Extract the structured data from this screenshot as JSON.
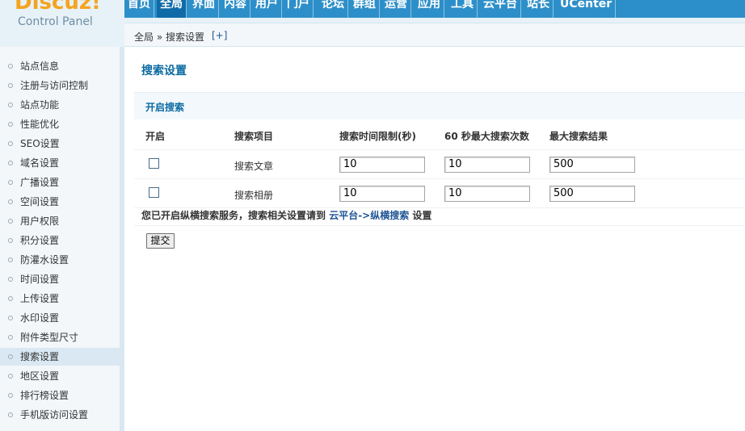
{
  "logo": {
    "brand": "Discuz!",
    "subtitle": "Control Panel"
  },
  "nav": {
    "items": [
      "首页",
      "全局",
      "界面",
      "内容",
      "用户",
      "门户",
      "论坛",
      "群组",
      "运营",
      "应用",
      "工具",
      "云平台",
      "站长",
      "UCenter"
    ],
    "active_index": 1
  },
  "breadcrumb": {
    "path": "全局 » 搜索设置",
    "add_label": "[+]"
  },
  "sidebar": {
    "items": [
      "站点信息",
      "注册与访问控制",
      "站点功能",
      "性能优化",
      "SEO设置",
      "域名设置",
      "广播设置",
      "空间设置",
      "用户权限",
      "积分设置",
      "防灌水设置",
      "时间设置",
      "上传设置",
      "水印设置",
      "附件类型尺寸",
      "搜索设置",
      "地区设置",
      "排行榜设置",
      "手机版访问设置"
    ],
    "active_index": 15
  },
  "page": {
    "title": "搜索设置",
    "section_title": "开启搜索"
  },
  "table": {
    "headers": [
      "开启",
      "搜索项目",
      "搜索时间限制(秒)",
      "60 秒最大搜索次数",
      "最大搜索结果"
    ],
    "rows": [
      {
        "enabled": false,
        "item": "搜索文章",
        "time_limit": "10",
        "max_per_minute": "10",
        "max_results": "500"
      },
      {
        "enabled": false,
        "item": "搜索相册",
        "time_limit": "10",
        "max_per_minute": "10",
        "max_results": "500"
      }
    ]
  },
  "notice": {
    "prefix": "您已开启纵横搜索服务，搜索相关设置请到 ",
    "link": "云平台->纵横搜索",
    "suffix": " 设置"
  },
  "submit_label": "提交",
  "colors": {
    "nav_bg": "#2d8fc9",
    "nav_active": "#0f6ba8",
    "title": "#0a6aa1",
    "logo": "#f4a41e"
  }
}
